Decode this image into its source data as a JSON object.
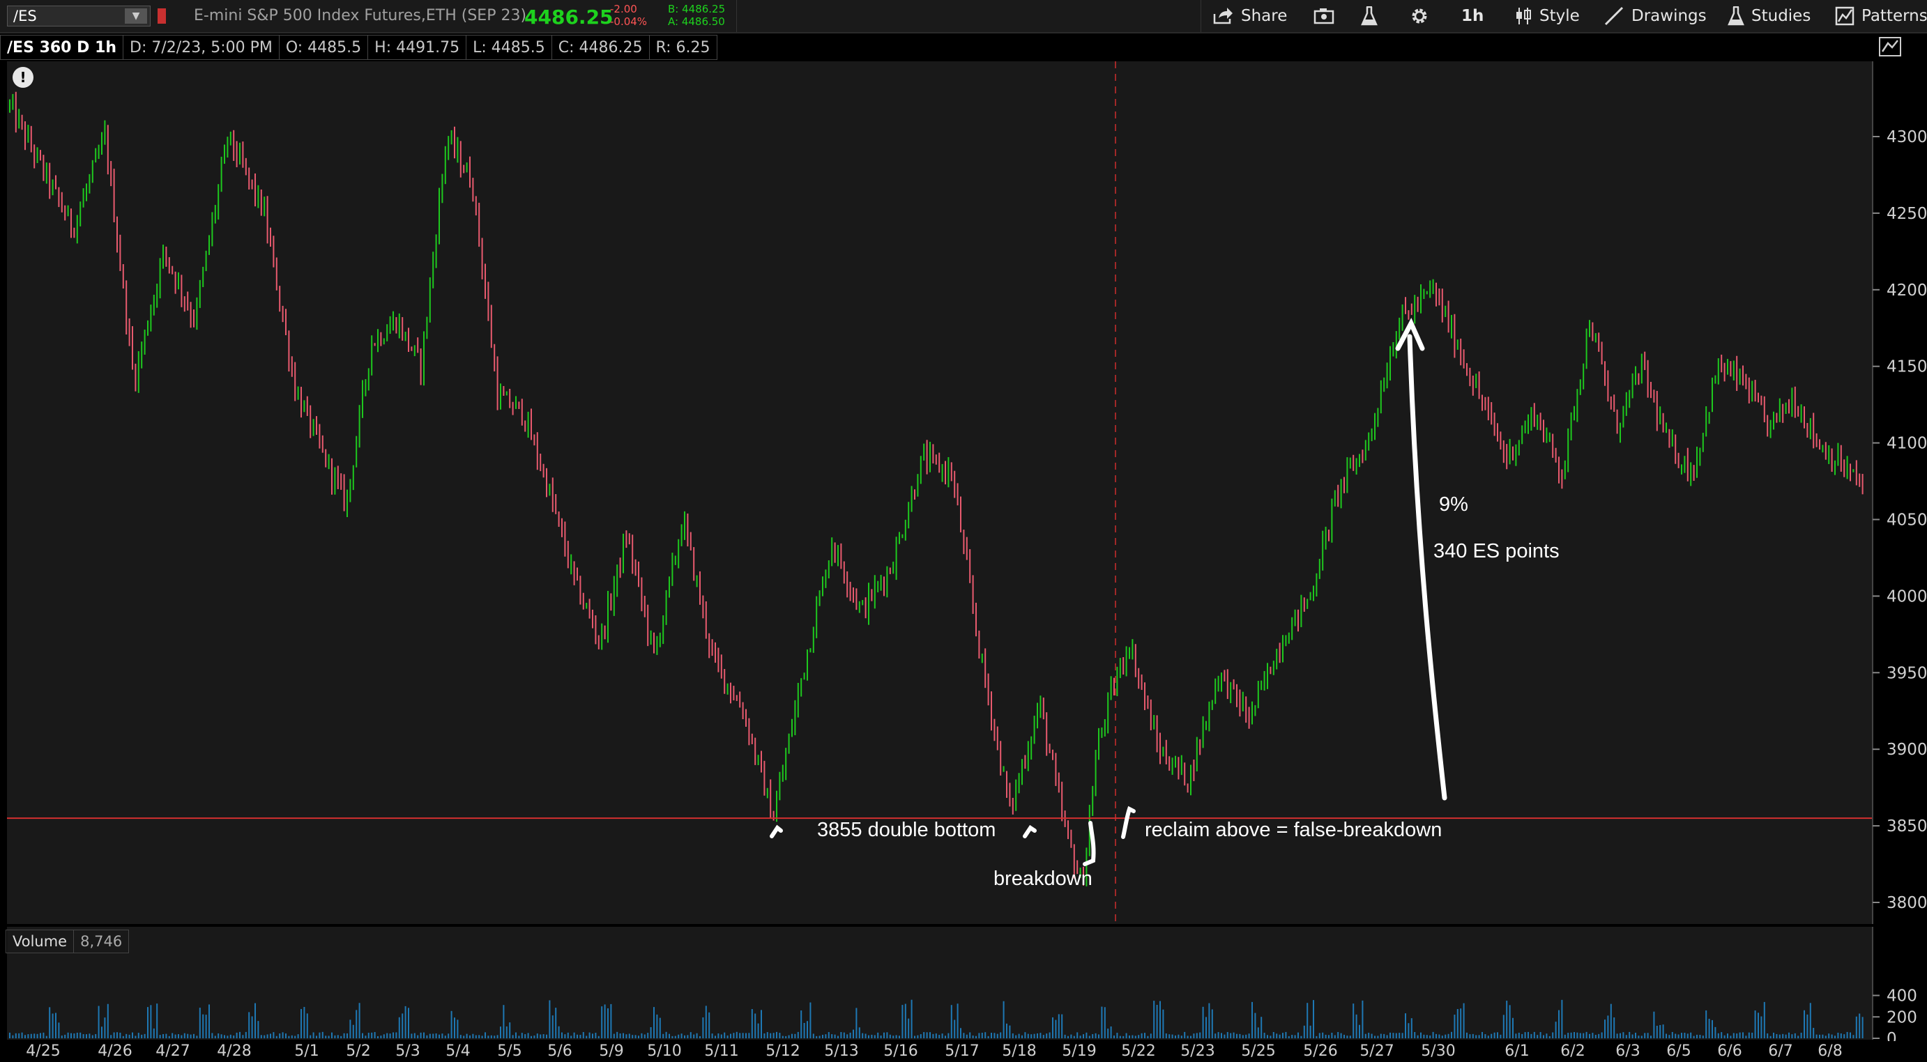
{
  "toolbar": {
    "symbol": "/ES",
    "instrument": "E-mini S&P 500 Index Futures,ETH (SEP 23)",
    "last_price": "4486.25",
    "change": "-2.00",
    "change_pct": "-0.04%",
    "bid": "B: 4486.25",
    "ask": "A: 4486.50",
    "buttons": {
      "share": "Share",
      "interval": "1h",
      "style": "Style",
      "drawings": "Drawings",
      "studies": "Studies",
      "patterns": "Patterns"
    }
  },
  "info_bar": {
    "cells": [
      "/ES 360 D 1h",
      "D: 7/2/23, 5:00 PM",
      "O: 4485.5",
      "H: 4491.75",
      "L: 4485.5",
      "C: 4486.25",
      "R: 6.25"
    ]
  },
  "volume": {
    "label": "Volume",
    "value": "8,746"
  },
  "annotations": {
    "double_bottom": "3855 double bottom",
    "breakdown": "breakdown",
    "reclaim": "reclaim above = false-breakdown",
    "pct": "9%",
    "points": "340 ES points"
  },
  "colors": {
    "up": "#1ec81e",
    "down": "#e85a6e",
    "level_line": "#d32f2f",
    "volume": "#1e78b4",
    "background": "#191919"
  },
  "chart_data": {
    "type": "candlestick",
    "instrument": "/ES",
    "interval": "1h",
    "x_tick_labels": [
      "4/25",
      "4/26",
      "4/27",
      "4/28",
      "5/1",
      "5/2",
      "5/3",
      "5/4",
      "5/5",
      "5/6",
      "5/9",
      "5/10",
      "5/11",
      "5/12",
      "5/13",
      "5/16",
      "5/17",
      "5/18",
      "5/19",
      "5/22",
      "5/23",
      "5/25",
      "5/26",
      "5/27",
      "5/30",
      "6/1",
      "6/2",
      "6/3",
      "6/5",
      "6/6",
      "6/7",
      "6/8"
    ],
    "y_ticks": [
      3800,
      3850,
      3900,
      3950,
      4000,
      4050,
      4100,
      4150,
      4200,
      4250,
      4300
    ],
    "ylim": [
      3790,
      4315
    ],
    "horizontal_level": 3855,
    "vertical_marker_session": "5/20",
    "price_path": [
      [
        "4/25",
        4320
      ],
      [
        "4/25",
        4240
      ],
      [
        "4/26",
        4300
      ],
      [
        "4/26",
        4140
      ],
      [
        "4/27",
        4225
      ],
      [
        "4/27",
        4180
      ],
      [
        "4/28",
        4300
      ],
      [
        "4/28",
        4250
      ],
      [
        "5/1",
        4135
      ],
      [
        "5/1",
        4095
      ],
      [
        "5/2",
        4060
      ],
      [
        "5/2",
        4165
      ],
      [
        "5/3",
        4180
      ],
      [
        "5/3",
        4150
      ],
      [
        "5/4",
        4300
      ],
      [
        "5/4",
        4270
      ],
      [
        "5/5",
        4130
      ],
      [
        "5/5",
        4120
      ],
      [
        "5/6",
        4070
      ],
      [
        "5/6",
        4010
      ],
      [
        "5/9",
        3970
      ],
      [
        "5/9",
        4040
      ],
      [
        "5/10",
        3960
      ],
      [
        "5/10",
        4050
      ],
      [
        "5/11",
        3960
      ],
      [
        "5/11",
        3925
      ],
      [
        "5/12",
        3855
      ],
      [
        "5/12",
        3950
      ],
      [
        "5/13",
        4035
      ],
      [
        "5/13",
        3990
      ],
      [
        "5/16",
        4020
      ],
      [
        "5/16",
        4090
      ],
      [
        "5/17",
        4080
      ],
      [
        "5/17",
        3960
      ],
      [
        "5/18",
        3860
      ],
      [
        "5/18",
        3930
      ],
      [
        "5/19",
        3850
      ],
      [
        "5/19",
        3810
      ],
      [
        "5/20",
        3900
      ],
      [
        "5/20",
        3930
      ],
      [
        "5/22",
        3970
      ],
      [
        "5/22",
        3900
      ],
      [
        "5/23",
        3880
      ],
      [
        "5/23",
        3950
      ],
      [
        "5/25",
        3920
      ],
      [
        "5/25",
        3970
      ],
      [
        "5/26",
        4000
      ],
      [
        "5/26",
        4070
      ],
      [
        "5/27",
        4100
      ],
      [
        "5/27",
        4180
      ],
      [
        "5/30",
        4200
      ],
      [
        "5/30",
        4140
      ],
      [
        "6/1",
        4090
      ],
      [
        "6/1",
        4120
      ],
      [
        "6/2",
        4080
      ],
      [
        "6/2",
        4180
      ],
      [
        "6/3",
        4110
      ],
      [
        "6/3",
        4150
      ],
      [
        "6/5",
        4100
      ],
      [
        "6/5",
        4080
      ],
      [
        "6/6",
        4150
      ],
      [
        "6/6",
        4140
      ],
      [
        "6/7",
        4110
      ],
      [
        "6/7",
        4130
      ],
      [
        "6/8",
        4100
      ],
      [
        "6/8",
        4070
      ]
    ],
    "volume_y_ticks": [
      0,
      200,
      400
    ]
  }
}
